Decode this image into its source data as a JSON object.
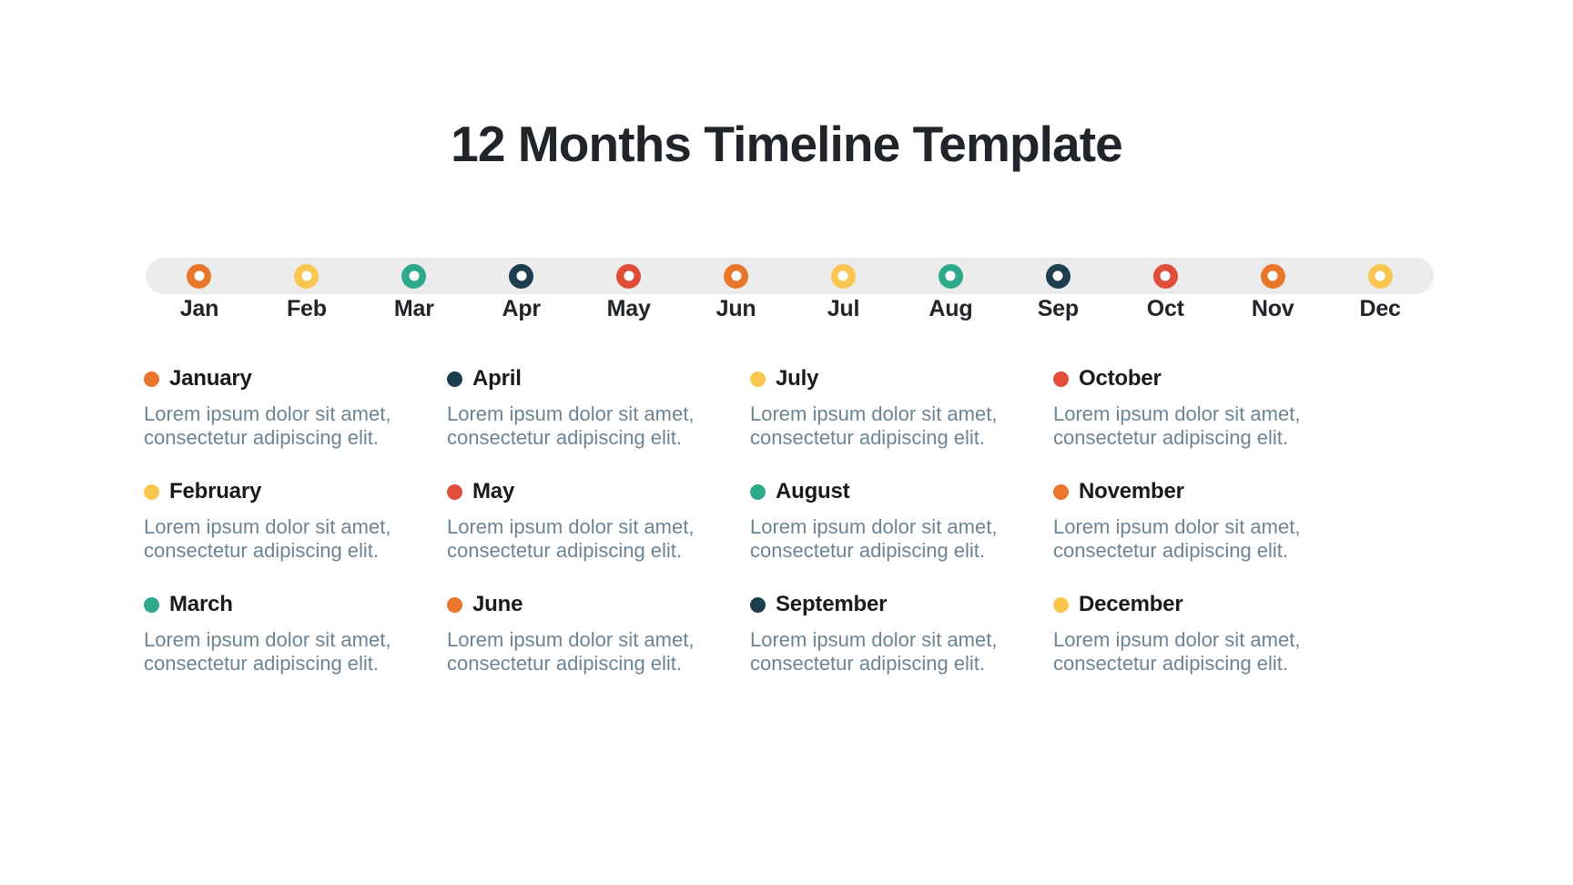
{
  "page": {
    "title": "12 Months Timeline Template",
    "background_color": "#ffffff",
    "bar_color": "#ececec"
  },
  "palette": {
    "orange": "#E8762C",
    "yellow": "#F9C74F",
    "teal": "#2EA98C",
    "navy": "#1D3E4E",
    "red": "#E04E39",
    "title_color": "#212529",
    "body_text_color": "#6d8494",
    "marker_inner_color": "#ffffff"
  },
  "timeline": {
    "markers": [
      {
        "label": "Jan",
        "color": "#E8762C",
        "icon": "ring-marker-icon"
      },
      {
        "label": "Feb",
        "color": "#F9C74F",
        "icon": "ring-marker-icon"
      },
      {
        "label": "Mar",
        "color": "#2EA98C",
        "icon": "ring-marker-icon"
      },
      {
        "label": "Apr",
        "color": "#1D3E4E",
        "icon": "ring-marker-icon"
      },
      {
        "label": "May",
        "color": "#E04E39",
        "icon": "ring-marker-icon"
      },
      {
        "label": "Jun",
        "color": "#E8762C",
        "icon": "ring-marker-icon"
      },
      {
        "label": "Jul",
        "color": "#F9C74F",
        "icon": "ring-marker-icon"
      },
      {
        "label": "Aug",
        "color": "#2EA98C",
        "icon": "ring-marker-icon"
      },
      {
        "label": "Sep",
        "color": "#1D3E4E",
        "icon": "ring-marker-icon"
      },
      {
        "label": "Oct",
        "color": "#E04E39",
        "icon": "ring-marker-icon"
      },
      {
        "label": "Nov",
        "color": "#E8762C",
        "icon": "ring-marker-icon"
      },
      {
        "label": "Dec",
        "color": "#F9C74F",
        "icon": "ring-marker-icon"
      }
    ]
  },
  "legend": {
    "items": [
      {
        "month": "January",
        "color": "#E8762C",
        "description": "Lorem ipsum dolor sit amet, consectetur adipiscing elit."
      },
      {
        "month": "April",
        "color": "#1D3E4E",
        "description": "Lorem ipsum dolor sit amet, consectetur adipiscing elit."
      },
      {
        "month": "July",
        "color": "#F9C74F",
        "description": "Lorem ipsum dolor sit amet, consectetur adipiscing elit."
      },
      {
        "month": "October",
        "color": "#E04E39",
        "description": "Lorem ipsum dolor sit amet, consectetur adipiscing elit."
      },
      {
        "month": "February",
        "color": "#F9C74F",
        "description": "Lorem ipsum dolor sit amet, consectetur adipiscing elit."
      },
      {
        "month": "May",
        "color": "#E04E39",
        "description": "Lorem ipsum dolor sit amet, consectetur adipiscing elit."
      },
      {
        "month": "August",
        "color": "#2EA98C",
        "description": "Lorem ipsum dolor sit amet, consectetur adipiscing elit."
      },
      {
        "month": "November",
        "color": "#E8762C",
        "description": "Lorem ipsum dolor sit amet, consectetur adipiscing elit."
      },
      {
        "month": "March",
        "color": "#2EA98C",
        "description": "Lorem ipsum dolor sit amet, consectetur adipiscing elit."
      },
      {
        "month": "June",
        "color": "#E8762C",
        "description": "Lorem ipsum dolor sit amet, consectetur adipiscing elit."
      },
      {
        "month": "September",
        "color": "#1D3E4E",
        "description": "Lorem ipsum dolor sit amet, consectetur adipiscing elit."
      },
      {
        "month": "December",
        "color": "#F9C74F",
        "description": "Lorem ipsum dolor sit amet, consectetur adipiscing elit."
      }
    ]
  }
}
